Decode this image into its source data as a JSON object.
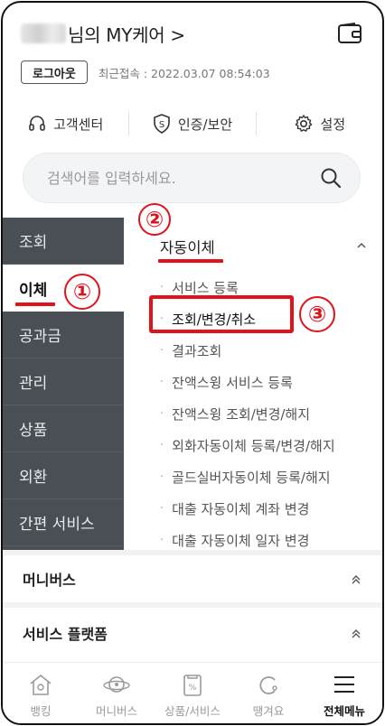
{
  "header": {
    "user_title": "님의 MY케어 >",
    "logout_label": "로그아웃",
    "last_login": "최근접속 : 2022.03.07 08:54:03"
  },
  "quick_links": [
    {
      "label": "고객센터",
      "icon": "headset-icon"
    },
    {
      "label": "인증/보안",
      "icon": "shield-icon"
    },
    {
      "label": "설정",
      "icon": "gear-icon"
    }
  ],
  "search": {
    "placeholder": "검색어를 입력하세요."
  },
  "sidenav": {
    "items": [
      "조회",
      "이체",
      "공과금",
      "관리",
      "상품",
      "외환",
      "간편 서비스"
    ],
    "active": "이체"
  },
  "submenu": {
    "heading": "자동이체",
    "items": [
      "서비스 등록",
      "조회/변경/취소",
      "결과조회",
      "잔액스윙 서비스 등록",
      "잔액스윙 조회/변경/해지",
      "외화자동이체 등록/변경/해지",
      "골드실버자동이체 등록/해지",
      "대출 자동이체 계좌 변경",
      "대출 자동이체 일자 변경"
    ],
    "highlighted": "조회/변경/취소"
  },
  "sections": [
    {
      "label": "머니버스"
    },
    {
      "label": "서비스 플랫폼"
    }
  ],
  "tabbar": [
    {
      "label": "뱅킹",
      "icon": "home-icon"
    },
    {
      "label": "머니버스",
      "icon": "planet-icon"
    },
    {
      "label": "상품/서비스",
      "icon": "product-icon"
    },
    {
      "label": "땡겨요",
      "icon": "delivery-icon"
    },
    {
      "label": "전체메뉴",
      "icon": "menu-icon"
    }
  ],
  "annotations": {
    "step1": "①",
    "step2": "②",
    "step3": "③",
    "color": "#e0131b"
  },
  "colors": {
    "sidenav_bg": "#4a4f56",
    "accent_red": "#e0131b"
  }
}
